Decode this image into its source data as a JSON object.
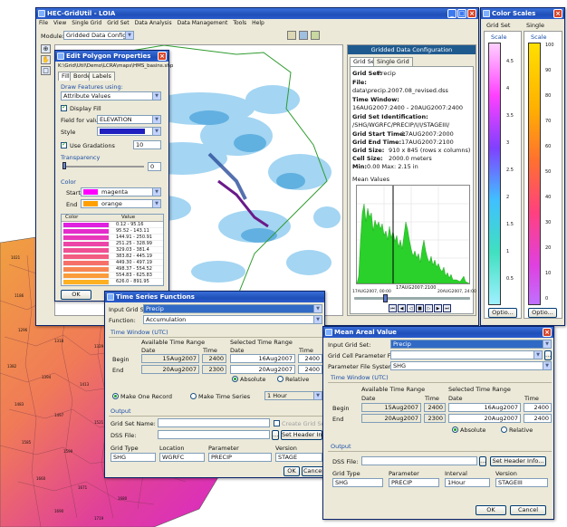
{
  "main": {
    "title": "HEC-GridUtil - LOIA",
    "menu": [
      "File",
      "View",
      "Single Grid",
      "Grid Set",
      "Data Analysis",
      "Data Management",
      "Tools",
      "Help"
    ],
    "module_label": "Module:",
    "module_value": "Gridded Data Configuration",
    "gridded_panel": {
      "header": "Gridded Data Configuration",
      "tabs": [
        "Grid Set",
        "Single Grid"
      ],
      "grid_set_label": "Grid Set:",
      "grid_set_value": "Precip",
      "file_label": "File:",
      "file_value": "data\\precip.2007.08_revised.dss",
      "time_window_label": "Time Window:",
      "time_window_value": "16AUG2007:2400 - 20AUG2007:2400",
      "grid_set_id_label": "Grid Set Identification:",
      "grid_set_id_value": "/SHG/WGRFC/PRECIP/I/I/STAGEIII/",
      "start_label": "Grid Start Time:",
      "start_value": "17AUG2007:2000",
      "end_label": "Grid End Time:",
      "end_value": "17AUG2007:2100",
      "size_label": "Grid Size:",
      "size_value": "910 x 845 (rows x columns)",
      "cell_label": "Cell Size:",
      "cell_value": "2000.0 meters",
      "minmax_label": "Min:",
      "minmax_value": "0.00  Max: 2.15 in",
      "mean_label": "Mean Values",
      "x_left": "17AUG2007, 00:00",
      "x_mid": "17AUG2007:2100",
      "x_right": "20AUG2007, 24:00"
    }
  },
  "color_scales": {
    "title": "Color Scales",
    "grid_set_tab": "Grid Set",
    "single_tab": "Single",
    "scale_label": "Scale",
    "left_ticks": [
      "4.5",
      "4",
      "3.5",
      "3",
      "2.5",
      "2",
      "1.5",
      "1",
      "0.5"
    ],
    "right_ticks": [
      "100",
      "90",
      "80",
      "70",
      "60",
      "50",
      "40",
      "30",
      "20",
      "10",
      "0"
    ],
    "options_label": "Optio..."
  },
  "polygon": {
    "title": "Edit Polygon Properties",
    "path": "K:\\Grid\\Util\\Demo\\LCRA\\maps\\HMS_basins.shp",
    "tabs": [
      "Fill",
      "Border",
      "Labels"
    ],
    "draw_label": "Draw Features using:",
    "draw_value": "Attribute Values",
    "display_fill": "Display Fill",
    "field_label": "Field for values:",
    "field_value": "ELEVATION",
    "style_label": "Style",
    "use_grad": "Use Gradations",
    "grad_value": "10",
    "transparency": "Transparency",
    "trans_value": "0",
    "color_group": "Color",
    "start_label": "Start",
    "start_value": "magenta",
    "end_label": "End",
    "end_value": "orange",
    "table_headers": [
      "Color",
      "Value"
    ],
    "rows": [
      {
        "color": "#e020e0",
        "value": "0.12 - 95.16"
      },
      {
        "color": "#e42ccd",
        "value": "95.52 - 143.11"
      },
      {
        "color": "#e838ba",
        "value": "144.91 - 250.91"
      },
      {
        "color": "#ec44a7",
        "value": "251.25 - 328.99"
      },
      {
        "color": "#f05094",
        "value": "329.03 - 381.4"
      },
      {
        "color": "#f35c81",
        "value": "383.82 - 445.19"
      },
      {
        "color": "#f6706a",
        "value": "449.30 - 497.19"
      },
      {
        "color": "#f88652",
        "value": "498.37 - 554.52"
      },
      {
        "color": "#fa9c3a",
        "value": "554.83 - 625.83"
      },
      {
        "color": "#fcb022",
        "value": "626.0 - 891.95"
      }
    ],
    "ok": "OK"
  },
  "map_labels": [
    "1021",
    "1077",
    "1190",
    "1186",
    "1106",
    "1186",
    "1290",
    "1296",
    "1318",
    "1329",
    "1343",
    "1371",
    "1382",
    "1394",
    "1413",
    "1426",
    "1441",
    "1467",
    "1483",
    "1497",
    "1521",
    "1556",
    "1564",
    "1585",
    "1599",
    "1605",
    "1623",
    "1660",
    "1671",
    "1680",
    "1690",
    "1719"
  ],
  "ts": {
    "title": "Time Series Functions",
    "input_label": "Input Grid Set:",
    "input_value": "Precip",
    "function_label": "Function:",
    "function_value": "Accumulation",
    "time_window": "Time Window (UTC)",
    "avail": "Available Time Range",
    "selected": "Selected Time Range",
    "date": "Date",
    "time": "Time",
    "begin": "Begin",
    "end": "End",
    "avail_begin_date": "15Aug2007",
    "avail_begin_time": "2400",
    "avail_end_date": "20Aug2007",
    "avail_end_time": "2300",
    "sel_begin_date": "16Aug2007",
    "sel_begin_time": "2400",
    "sel_end_date": "20Aug2007",
    "sel_end_time": "2400",
    "absolute": "Absolute",
    "relative": "Relative",
    "one_record": "Make One Record",
    "time_series": "Make Time Series",
    "interval": "1 Hour",
    "output": "Output",
    "grid_set_name": "Grid Set Name:",
    "create_grid_set": "Create Grid Set",
    "dss_file": "DSS File:",
    "set_header": "Set Header Info...",
    "grid_type": "Grid Type",
    "location": "Location",
    "parameter": "Parameter",
    "version": "Version",
    "grid_type_value": "SHG",
    "location_value": "WGRFC",
    "parameter_value": "PRECIP",
    "version_value": "STAGE",
    "ok": "OK",
    "cancel": "Cancel"
  },
  "mav": {
    "title": "Mean Areal Value",
    "input_label": "Input Grid Set:",
    "input_value": "Precip",
    "gcp_label": "Grid Cell Parameter File:",
    "pfs_label": "Parameter File System:",
    "pfs_value": "SHG",
    "time_window": "Time Window (UTC)",
    "avail": "Available Time Range",
    "selected": "Selected Time Range",
    "date": "Date",
    "time": "Time",
    "begin": "Begin",
    "end": "End",
    "avail_begin_date": "15Aug2007",
    "avail_begin_time": "2400",
    "avail_end_date": "20Aug2007",
    "avail_end_time": "2300",
    "sel_begin_date": "16Aug2007",
    "sel_begin_time": "2400",
    "sel_end_date": "20Aug2007",
    "sel_end_time": "2400",
    "absolute": "Absolute",
    "relative": "Relative",
    "output": "Output",
    "dss_file": "DSS File:",
    "set_header": "Set Header Info...",
    "grid_type": "Grid Type",
    "parameter": "Parameter",
    "interval": "Interval",
    "version": "Version",
    "grid_type_value": "SHG",
    "parameter_value": "PRECIP",
    "interval_value": "1Hour",
    "version_value": "STAGEIII",
    "ok": "OK",
    "cancel": "Cancel"
  }
}
